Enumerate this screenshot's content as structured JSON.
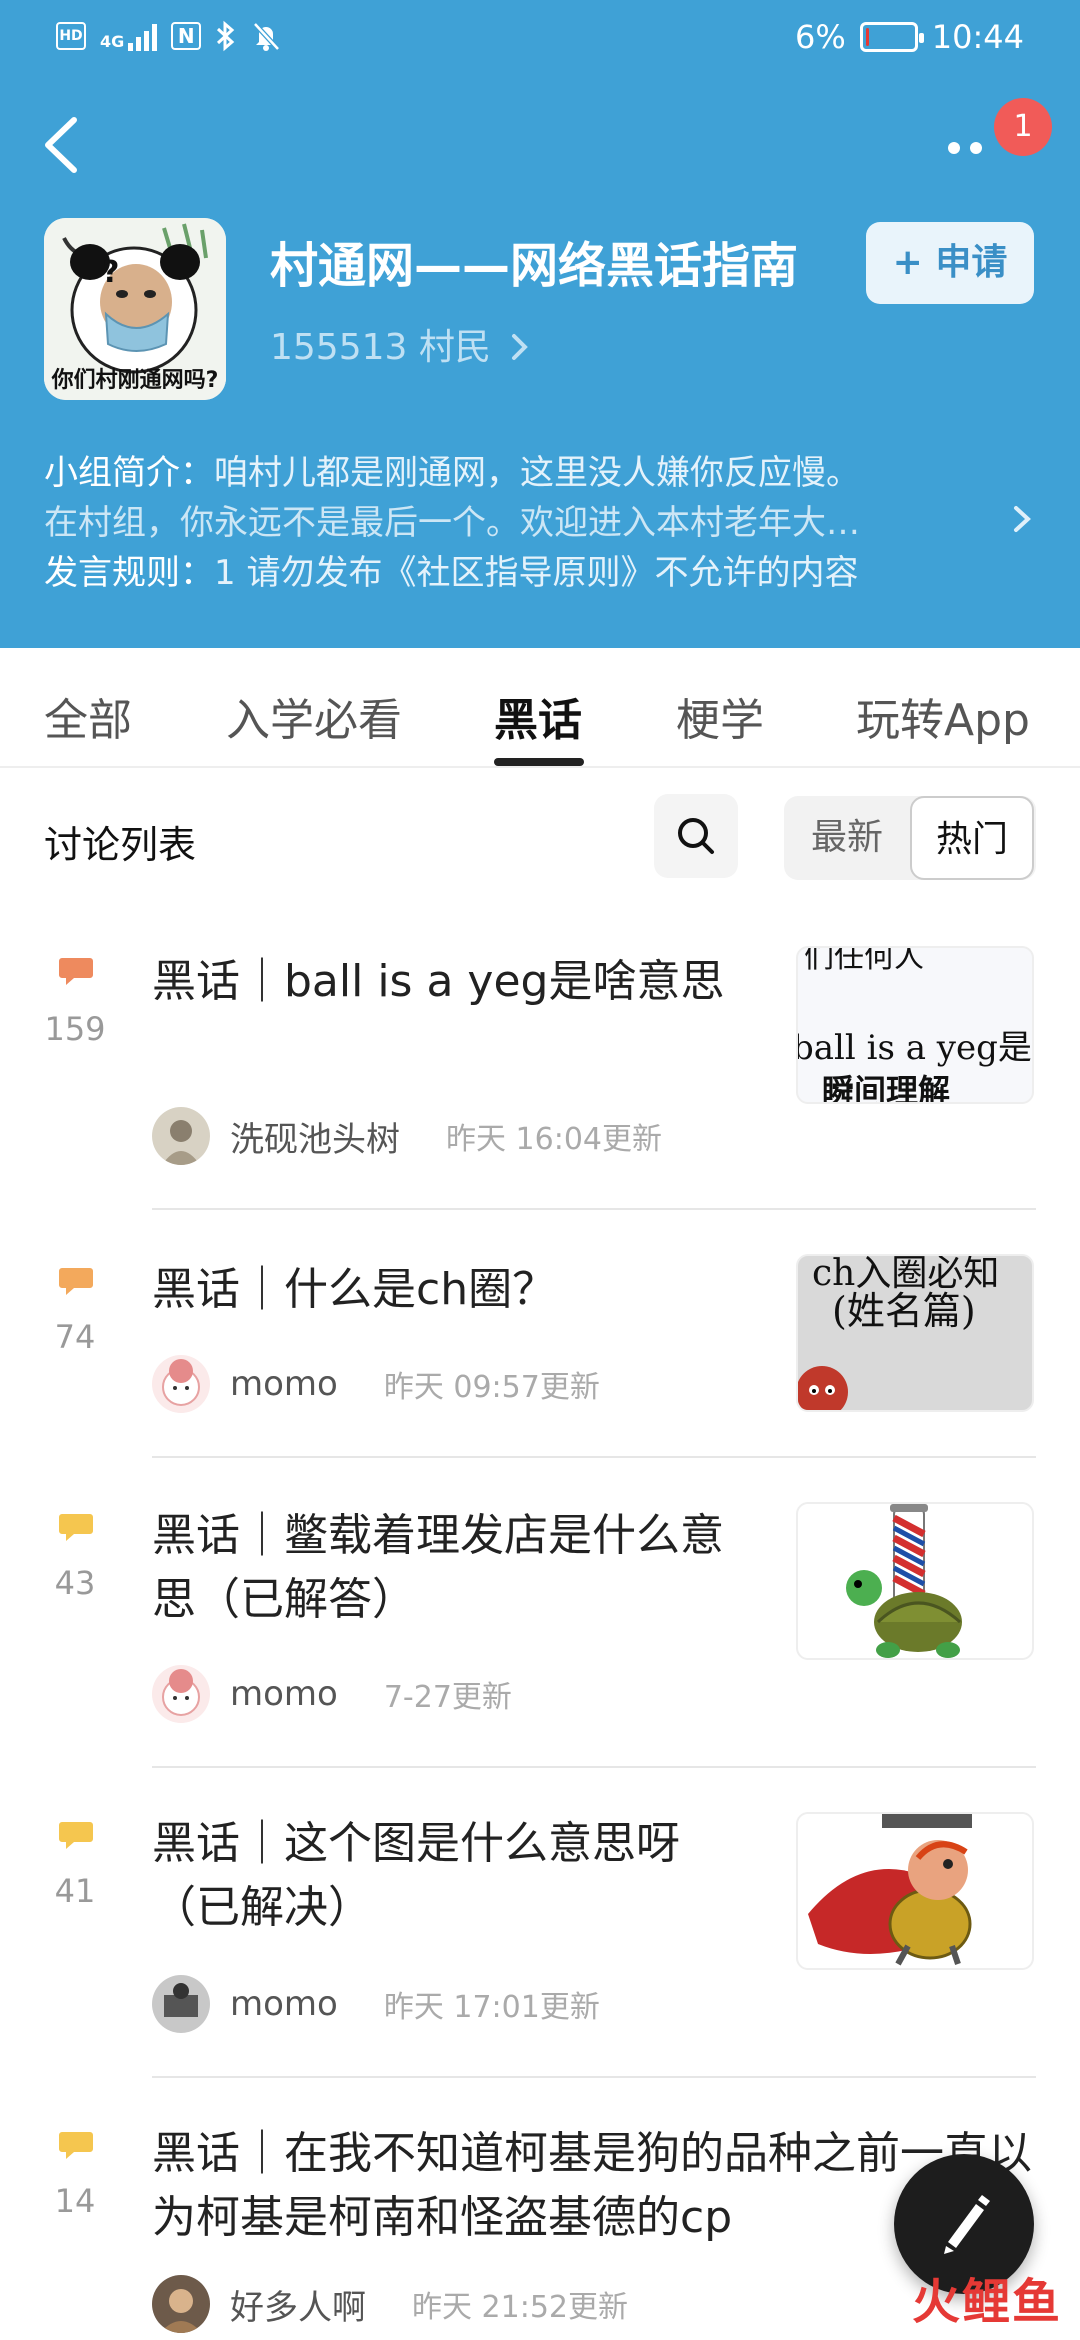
{
  "status_bar": {
    "network_label": "HD",
    "signal_label": "4G",
    "nfc_label": "N",
    "battery_percent": "6%",
    "battery_level": 0.06,
    "time": "10:44"
  },
  "header": {
    "notification_count": "1",
    "avatar_caption": "你们村刚通网吗?",
    "group_name": "村通网——网络黑话指南",
    "members": "155513 村民",
    "apply_button": "+ 申请",
    "intro_label": "小组简介：",
    "intro_line1": "咱村儿都是刚通网，这里没人嫌你反应慢。",
    "intro_line2": "在村组，你永远不是最后一个。欢迎进入本村老年大…",
    "rules_label": "发言规则：",
    "rules_text": "1 请勿发布《社区指导原则》不允许的内容"
  },
  "tabs": [
    {
      "label": "全部",
      "active": false
    },
    {
      "label": "入学必看",
      "active": false
    },
    {
      "label": "黑话",
      "active": true
    },
    {
      "label": "梗学",
      "active": false
    },
    {
      "label": "玩转App",
      "active": false
    }
  ],
  "list_bar": {
    "title": "讨论列表",
    "sort_new": "最新",
    "sort_hot": "热门",
    "selected_sort": "热门"
  },
  "posts": [
    {
      "count": "159",
      "icon_color": "#ee8a5e",
      "title": "黑话｜ball is a yeg是啥意思",
      "author": "洗砚池头树",
      "time": "昨天 16:04更新",
      "thumb_line1": "们任何人",
      "thumb_line2": "ball is a yeg是",
      "thumb_line3": "瞬间理解"
    },
    {
      "count": "74",
      "icon_color": "#f3a95c",
      "title": "黑话｜什么是ch圈？",
      "author": "momo",
      "time": "昨天 09:57更新",
      "thumb_line1": "ch入圈必知",
      "thumb_line2": "(姓名篇)"
    },
    {
      "count": "43",
      "icon_color": "#f5c64f",
      "title": "黑话｜鳖载着理发店是什么意思（已解答）",
      "author": "momo",
      "time": "7-27更新"
    },
    {
      "count": "41",
      "icon_color": "#f5c64f",
      "title": "黑话｜这个图是什么意思呀（已解决）",
      "author": "momo",
      "time": "昨天 17:01更新"
    },
    {
      "count": "14",
      "icon_color": "#f5c64f",
      "title": "黑话｜在我不知道柯基是狗的品种之前一直以为柯基是柯南和怪盗基德的cp",
      "author": "好多人啊",
      "time": "昨天 21:52更新"
    }
  ],
  "watermark": "火鲤鱼",
  "colors": {
    "header_bg": "#3fa1d6",
    "badge": "#f15b58",
    "fab": "#1d1d1d"
  },
  "icons": {
    "back": "chevron-left-icon",
    "more": "more-dots-icon",
    "search": "search-icon",
    "compose": "pen-icon",
    "comment": "comment-bubble-icon"
  }
}
